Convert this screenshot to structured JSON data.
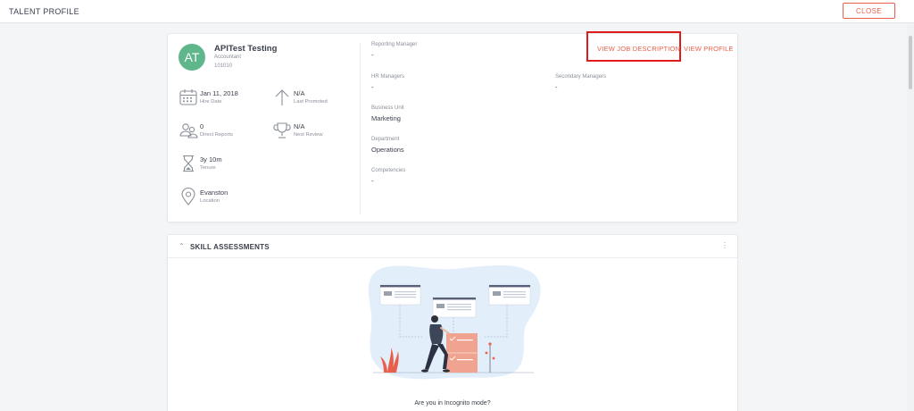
{
  "header": {
    "title": "TALENT PROFILE",
    "close_label": "CLOSE"
  },
  "profile": {
    "avatar_initials": "AT",
    "avatar_color": "#5fb68a",
    "name": "APITest Testing",
    "job_title": "Accountant",
    "employee_id": "101010",
    "stats": {
      "hire_date": {
        "value": "Jan 11, 2018",
        "label": "Hire Date",
        "icon": "calendar-icon"
      },
      "last_promoted": {
        "value": "N/A",
        "label": "Last Promoted",
        "icon": "arrow-up-icon"
      },
      "direct_reports": {
        "value": "0",
        "label": "Direct Reports",
        "icon": "people-icon"
      },
      "next_review": {
        "value": "N/A",
        "label": "Next Review",
        "icon": "trophy-icon"
      },
      "tenure": {
        "value": "3y 10m",
        "label": "Tenure",
        "icon": "hourglass-icon"
      },
      "location": {
        "value": "Evanston",
        "label": "Location",
        "icon": "location-pin-icon"
      }
    },
    "details": {
      "reporting_manager": {
        "label": "Reporting Manager",
        "value": "-"
      },
      "hr_managers": {
        "label": "HR Managers",
        "value": "-"
      },
      "secondary_managers": {
        "label": "Secondary Managers",
        "value": "-"
      },
      "business_unit": {
        "label": "Business Unit",
        "value": "Marketing"
      },
      "department": {
        "label": "Department",
        "value": "Operations"
      },
      "competencies": {
        "label": "Competencies",
        "value": "-"
      }
    },
    "links": {
      "view_job_description": "VIEW JOB DESCRIPTION",
      "view_profile": "VIEW PROFILE"
    }
  },
  "skills": {
    "title": "SKILL ASSESSMENTS",
    "empty_message": "Are you in Incognito mode?"
  },
  "colors": {
    "accent": "#e8604c",
    "highlight": "#e01b1b"
  }
}
